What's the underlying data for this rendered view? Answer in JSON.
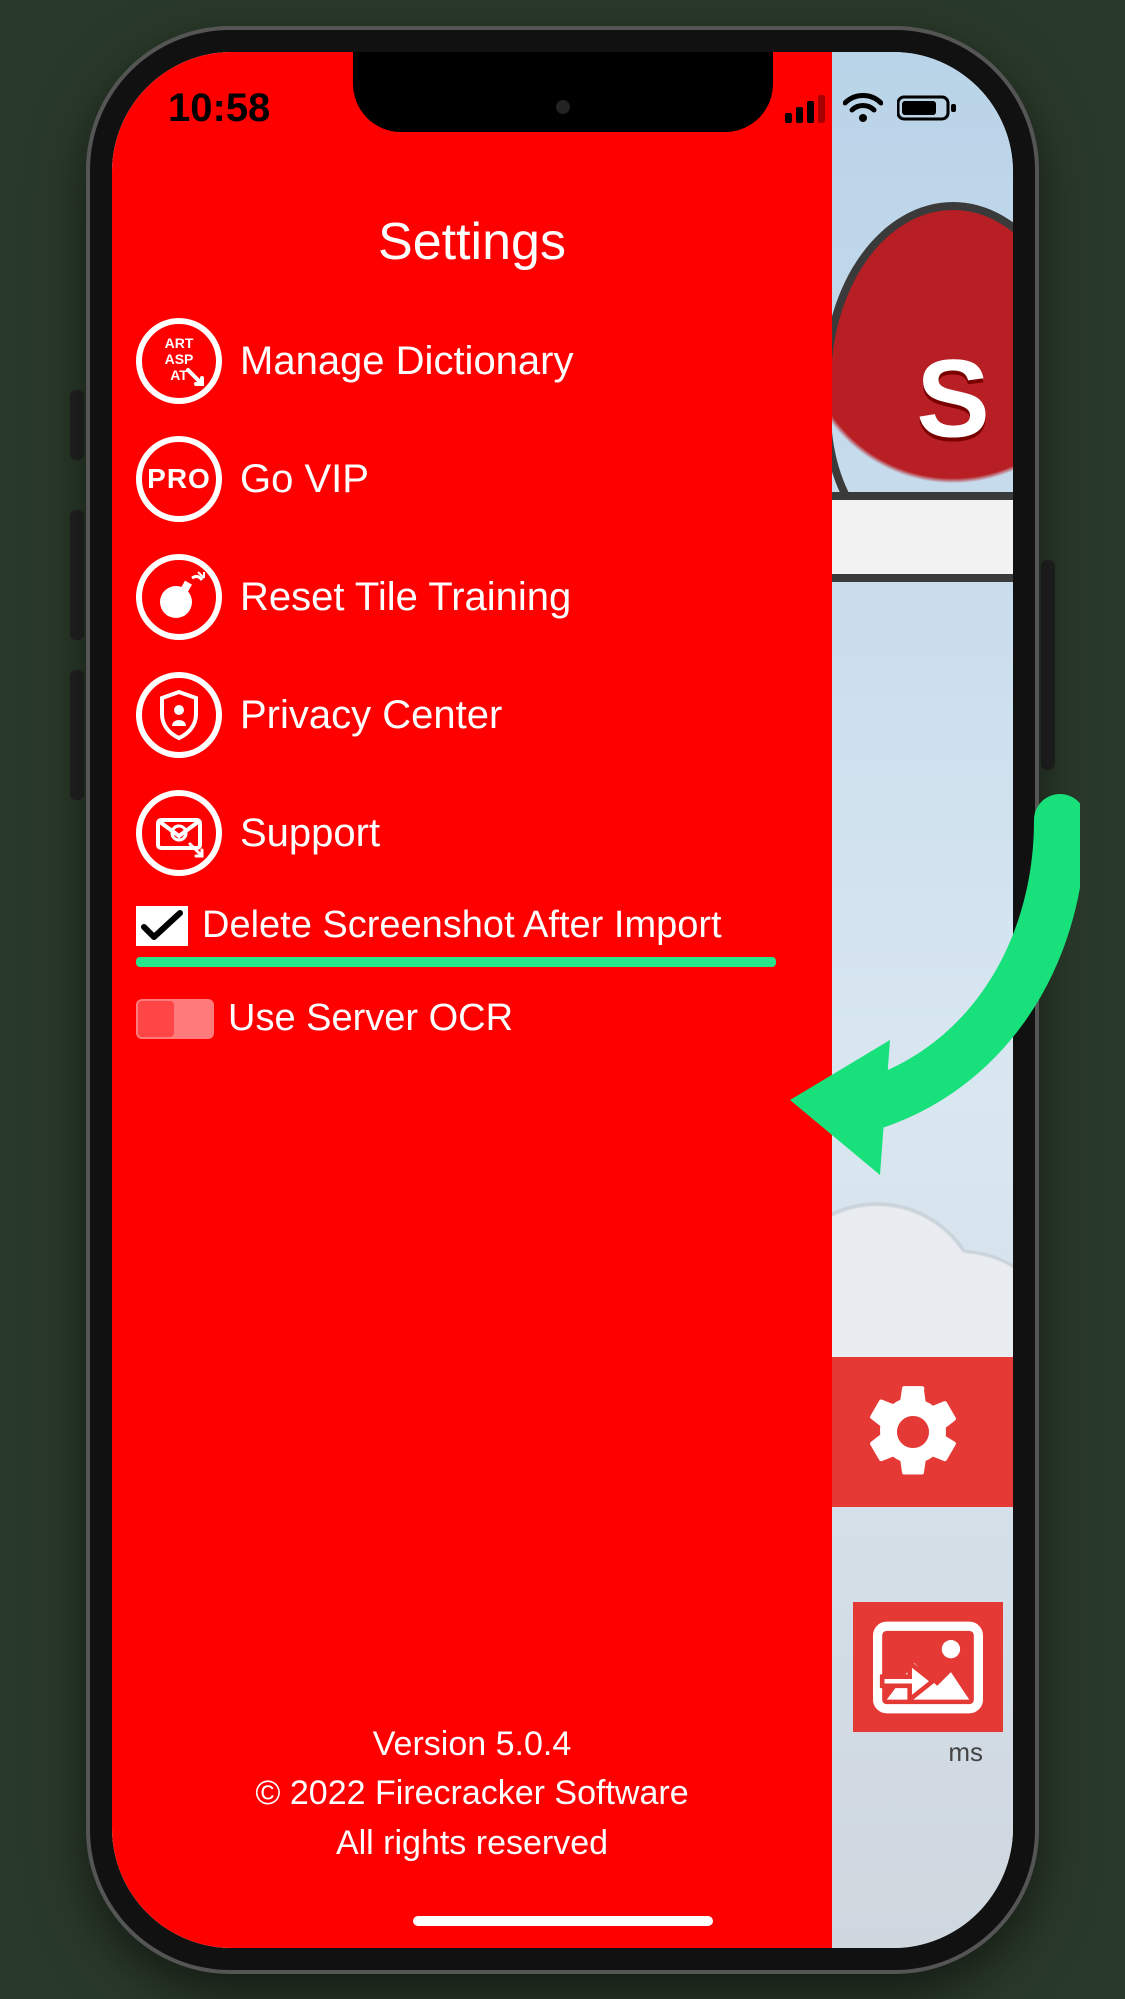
{
  "status": {
    "time": "10:58"
  },
  "header": {
    "title": "Settings"
  },
  "menu": {
    "items": [
      {
        "label": "Manage Dictionary"
      },
      {
        "label": "Go VIP"
      },
      {
        "label": "Reset Tile Training"
      },
      {
        "label": "Privacy Center"
      },
      {
        "label": "Support"
      }
    ]
  },
  "options": {
    "delete_after_import": {
      "label": "Delete Screenshot After Import",
      "checked": true
    },
    "use_server_ocr": {
      "label": "Use Server OCR",
      "on": false
    }
  },
  "footer": {
    "version": "Version 5.0.4",
    "copyright": "© 2022 Firecracker Software",
    "rights": "All rights reserved"
  },
  "background": {
    "hat_letter": "S",
    "gallery_caption": "ms"
  },
  "colors": {
    "panel": "#ff0000",
    "accent": "#27e58b",
    "brand": "#e53935"
  }
}
